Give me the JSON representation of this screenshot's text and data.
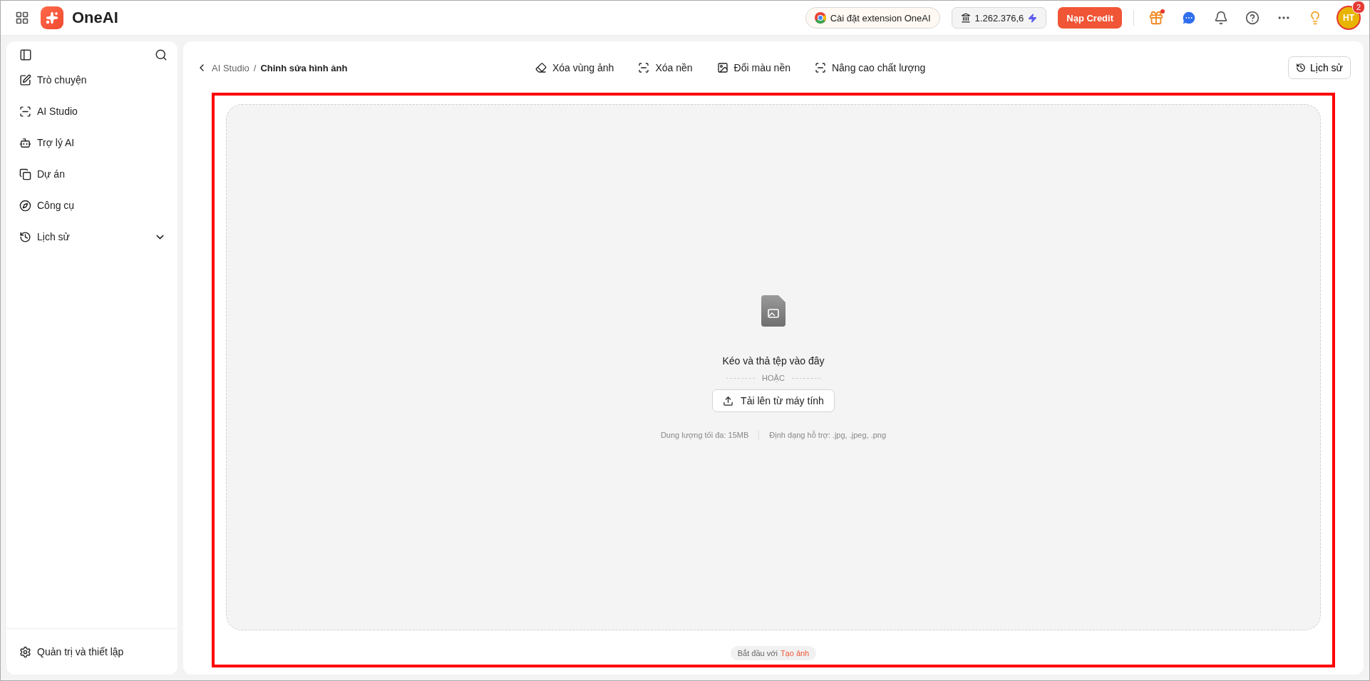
{
  "topbar": {
    "brand": "OneAI",
    "extension_button": "Cài đặt extension OneAI",
    "credits": "1.262.376,6",
    "topup_button": "Nạp Credit",
    "gift_has_dot": true,
    "avatar": {
      "initials": "HT",
      "badge": "2"
    }
  },
  "sidebar": {
    "items": [
      {
        "label": "Trò chuyện",
        "kind": "link"
      },
      {
        "label": "AI Studio",
        "kind": "link"
      },
      {
        "label": "Trợ lý AI",
        "kind": "link"
      },
      {
        "label": "Dự án",
        "kind": "link"
      },
      {
        "label": "Công cụ",
        "kind": "link"
      },
      {
        "label": "Lịch sử",
        "kind": "group",
        "expanded": false
      }
    ],
    "footer": "Quản trị và thiết lập"
  },
  "breadcrumb": {
    "parent": "AI Studio",
    "separator": "/",
    "current": "Chỉnh sửa hình ảnh"
  },
  "tools": [
    {
      "label": "Xóa vùng ảnh",
      "selected": false
    },
    {
      "label": "Xóa nền",
      "selected": false
    },
    {
      "label": "Đổi màu nền",
      "selected": false
    },
    {
      "label": "Nâng cao chất lượng",
      "selected": false
    }
  ],
  "history_button": "Lịch sử",
  "dropzone": {
    "title": "Kéo và thả tệp vào đây",
    "divider": "HOẶC",
    "upload_button": "Tải lên từ máy tính",
    "max_size": "Dung lượng tối đa: 15MB",
    "formats": "Định dạng hỗ trợ: .jpg, .jpeg, .png"
  },
  "start_hint": {
    "prefix": "Bắt đầu với",
    "link": "Tạo ảnh"
  },
  "highlight": true
}
